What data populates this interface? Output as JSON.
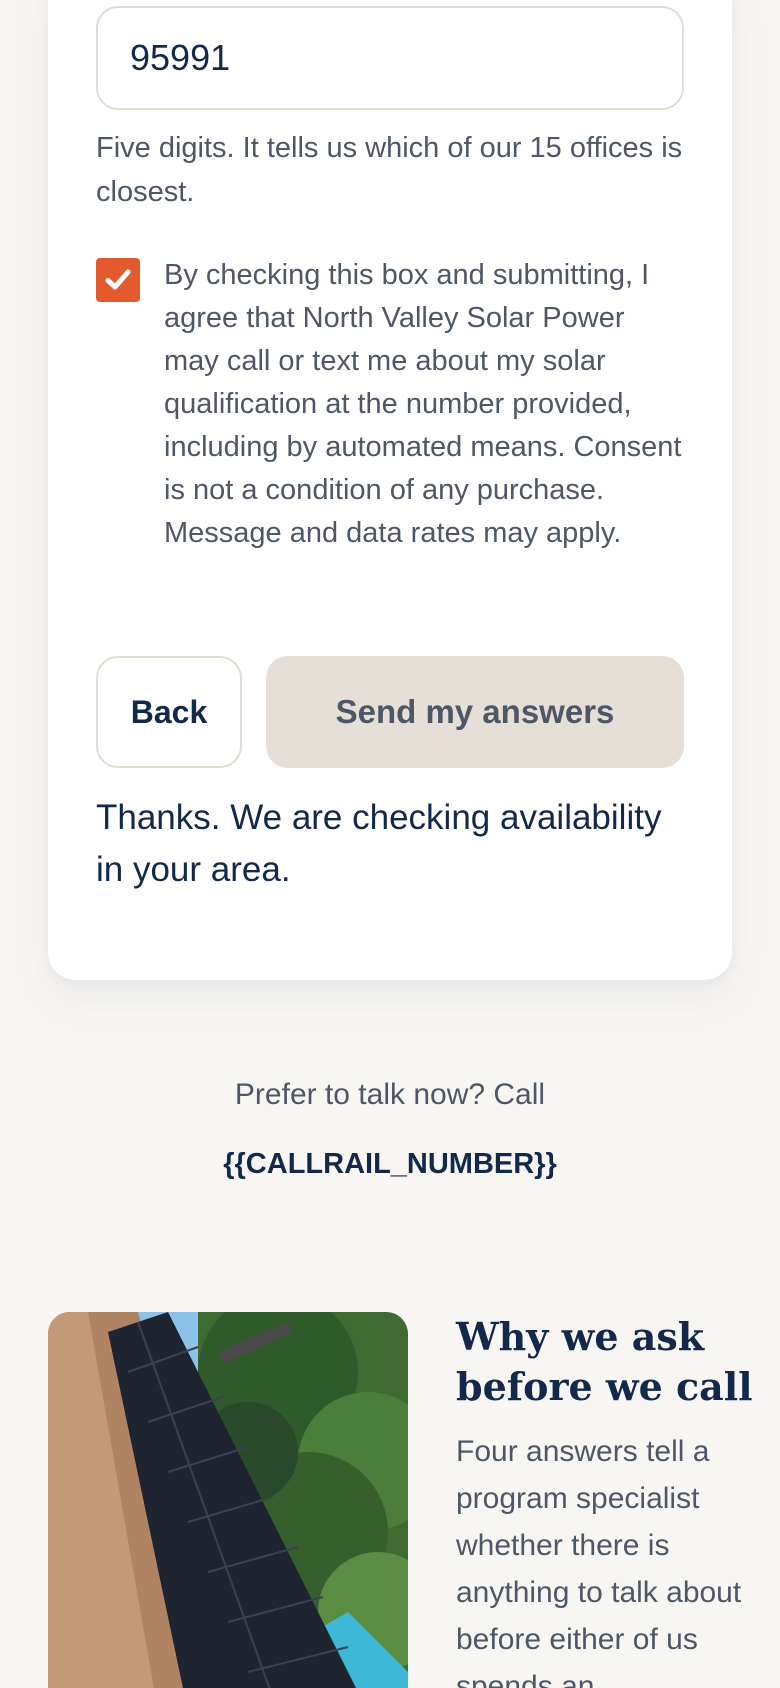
{
  "form": {
    "zip_value": "95991",
    "zip_help": "Five digits. It tells us which of our 15 offices is closest.",
    "consent_checked": true,
    "consent_text": "By checking this box and submitting, I agree that North Valley Solar Power may call or text me about my solar qualification at the number provided, including by automated means. Consent is not a condition of any purchase. Message and data rates may apply.",
    "back_label": "Back",
    "submit_label": "Send my answers",
    "status_message": "Thanks. We are checking availability in your area."
  },
  "call": {
    "prompt": "Prefer to talk now? Call",
    "number": "{{CALLRAIL_NUMBER}}"
  },
  "why": {
    "title": "Why we ask before we call",
    "body": "Four answers tell a program specialist whether there is anything to talk about before either of us spends an"
  },
  "colors": {
    "accent": "#e45a2f",
    "navy": "#13294b",
    "muted_text": "#4d5766",
    "page_bg": "#f8f6f3",
    "border": "#e2dbd0",
    "disabled_button": "#e5dfd7"
  },
  "icons": {
    "checkbox": "check-icon"
  }
}
